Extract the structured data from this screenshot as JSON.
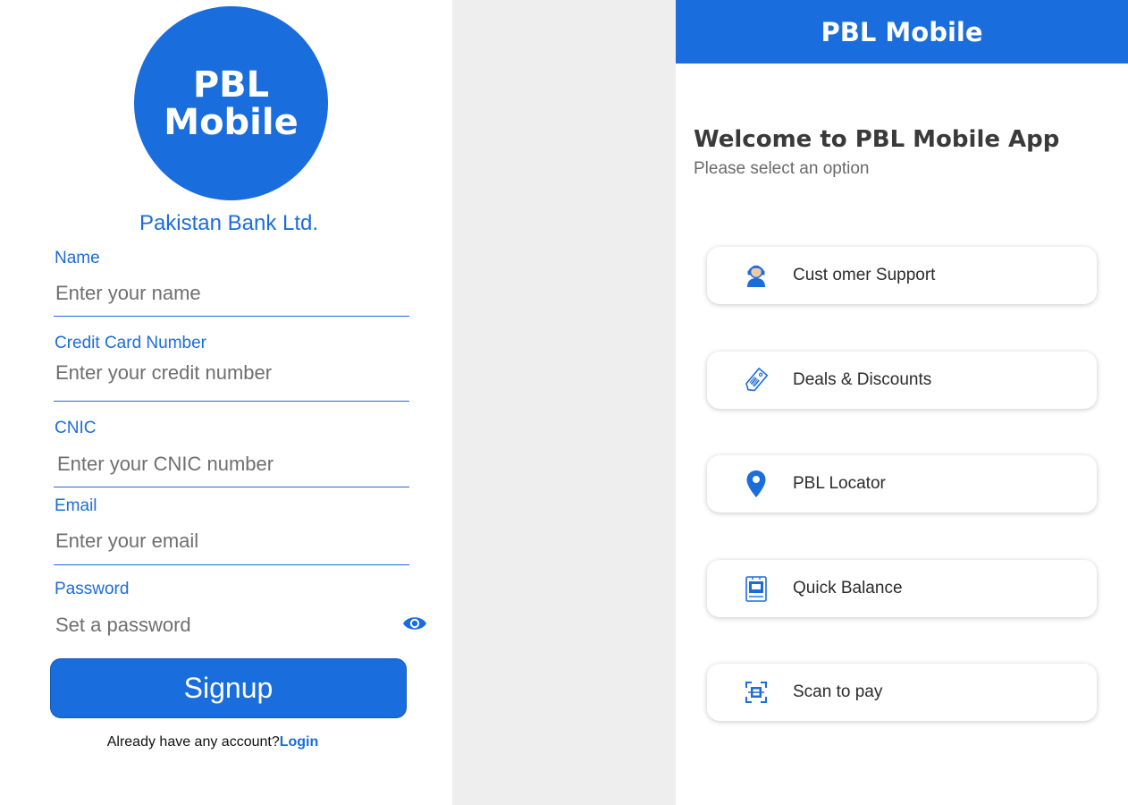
{
  "colors": {
    "brand": "#1a6ddc",
    "gap": "#eeeeee",
    "text_dark": "#3a3a3a"
  },
  "signup": {
    "logo_line1": "PBL",
    "logo_line2": "Mobile",
    "bank_name": "Pakistan Bank Ltd.",
    "fields": [
      {
        "label": "Name",
        "placeholder": "Enter your name",
        "value": ""
      },
      {
        "label": "Credit Card Number",
        "placeholder": "Enter your credit number",
        "value": ""
      },
      {
        "label": "CNIC",
        "placeholder": "Enter your CNIC number",
        "value": ""
      },
      {
        "label": "Email",
        "placeholder": "Enter your email",
        "value": ""
      },
      {
        "label": "Password",
        "placeholder": "Set a password",
        "value": "",
        "icon": "eye-icon"
      }
    ],
    "button_label": "Signup",
    "account_prompt": "Already have any account?",
    "login_link": "Login"
  },
  "home": {
    "header_title": "PBL Mobile",
    "welcome_title": "Welcome to PBL Mobile App",
    "welcome_subtitle": "Please select an option",
    "options": [
      {
        "label": "Cust omer Support",
        "icon": "customer-support-icon"
      },
      {
        "label": "Deals & Discounts",
        "icon": "price-tag-icon"
      },
      {
        "label": "PBL Locator",
        "icon": "location-pin-icon"
      },
      {
        "label": "Quick Balance",
        "icon": "balance-icon"
      },
      {
        "label": "Scan to pay",
        "icon": "qr-scan-icon"
      }
    ]
  }
}
